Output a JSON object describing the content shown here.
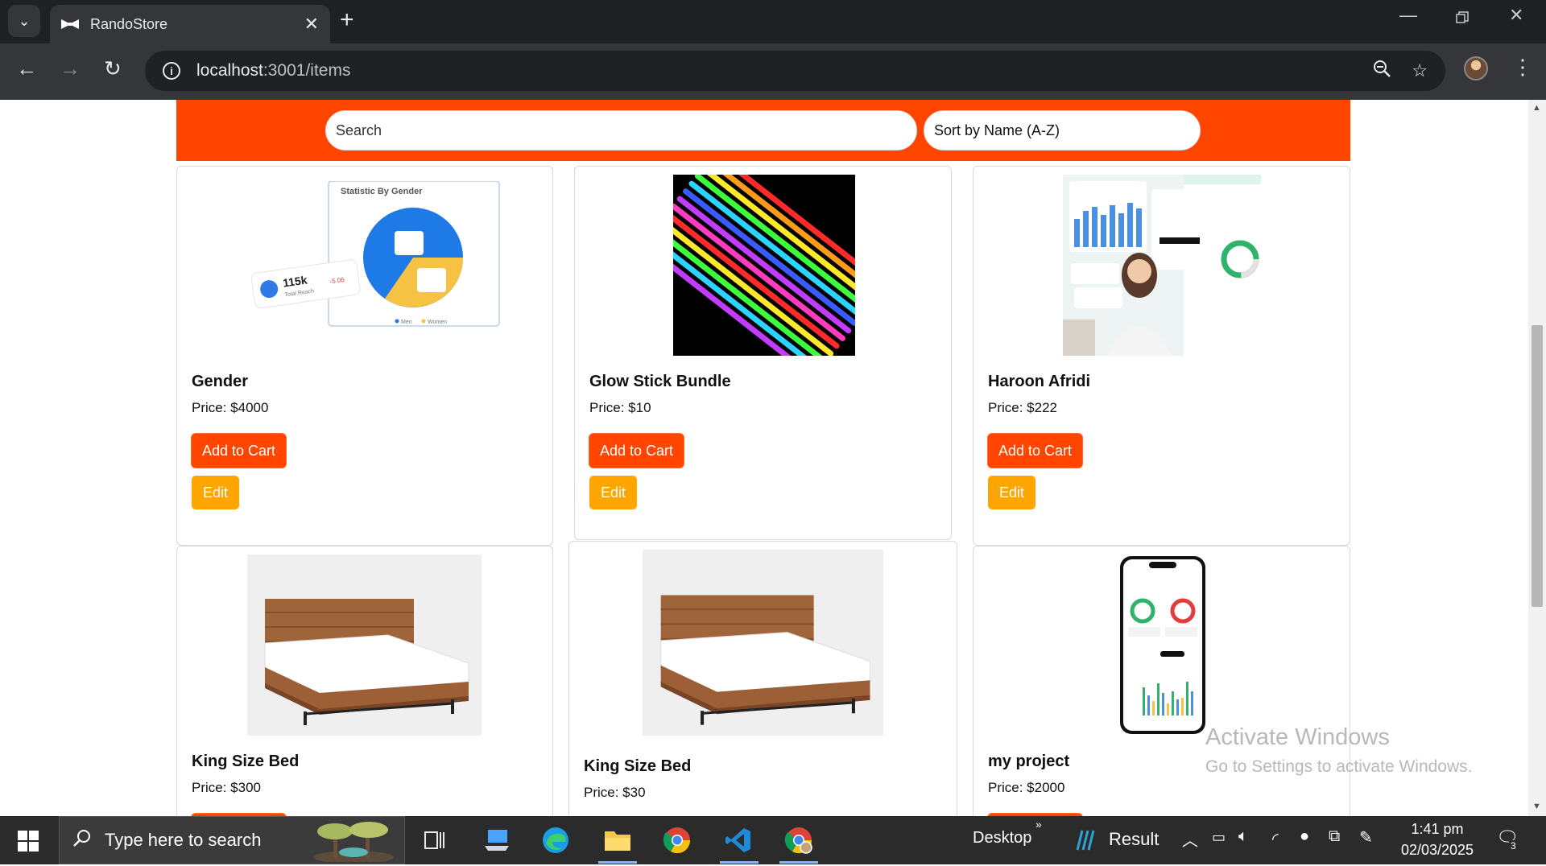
{
  "browser": {
    "tab_title": "RandoStore",
    "url_host": "localhost",
    "url_rest": ":3001/items"
  },
  "page": {
    "search_placeholder": "Search",
    "sort_value": "Sort by Name (A-Z)",
    "add_to_cart_label": "Add to Cart",
    "edit_label": "Edit",
    "items": [
      {
        "name": "Gender",
        "price": "Price: $4000"
      },
      {
        "name": "Glow Stick Bundle",
        "price": "Price: $10"
      },
      {
        "name": "Haroon Afridi",
        "price": "Price: $222"
      },
      {
        "name": "King Size Bed",
        "price": "Price: $300"
      },
      {
        "name": "King Size Bed",
        "price": "Price: $30"
      },
      {
        "name": "my project",
        "price": "Price: $2000"
      }
    ],
    "gender_img": {
      "title": "Statistic By Gender",
      "reach_value": "115k",
      "reach_label": "Total Reach",
      "reach_change": "-5.06",
      "legend_men": "Men",
      "legend_women": "Women"
    }
  },
  "watermark": {
    "title": "Activate Windows",
    "subtitle": "Go to Settings to activate Windows."
  },
  "taskbar": {
    "search_placeholder": "Type here to search",
    "desktop_label": "Desktop",
    "result_label": "Result",
    "time": "1:41 pm",
    "date": "02/03/2025",
    "notification_count": "3"
  },
  "colors": {
    "brand": "#ff4500",
    "edit": "#ffa500"
  }
}
